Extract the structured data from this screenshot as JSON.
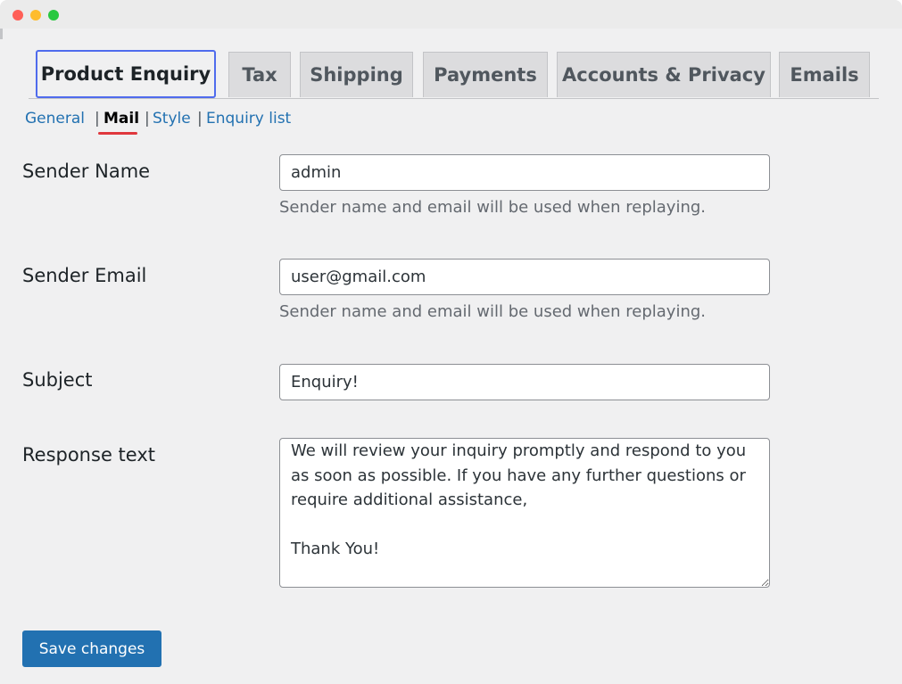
{
  "tabs": [
    {
      "label": "Product Enquiry",
      "active": true
    },
    {
      "label": "Tax"
    },
    {
      "label": "Shipping"
    },
    {
      "label": "Payments"
    },
    {
      "label": "Accounts & Privacy"
    },
    {
      "label": "Emails"
    }
  ],
  "subnav": {
    "items": [
      "General",
      "Mail",
      "Style",
      "Enquiry list"
    ],
    "separator": "|",
    "current": "Mail"
  },
  "form": {
    "sender_name": {
      "label": "Sender Name",
      "value": "admin",
      "description": "Sender name and email will be used when replaying."
    },
    "sender_email": {
      "label": "Sender Email",
      "value": "user@gmail.com",
      "description": "Sender name and email will be used when replaying."
    },
    "subject": {
      "label": "Subject",
      "value": "Enquiry!"
    },
    "response_text": {
      "label": "Response text",
      "value": "We will review your inquiry promptly and respond to you as soon as possible. If you have any further questions or require additional assistance,\n\nThank You!"
    }
  },
  "save_button": {
    "label": "Save changes"
  },
  "colors": {
    "primary": "#2271b1",
    "active_tab_border": "#4f6bed",
    "current_underline": "#e0383e",
    "background": "#f0f0f1"
  }
}
